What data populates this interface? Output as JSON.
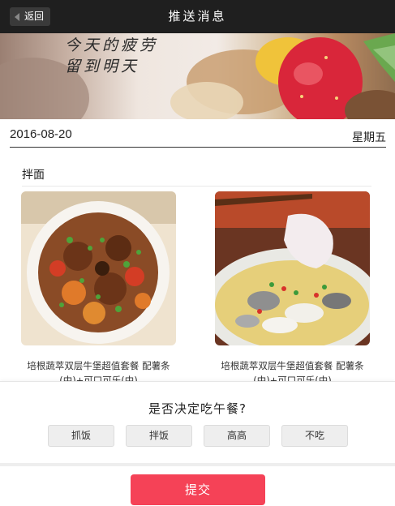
{
  "header": {
    "back_label": "返回",
    "title": "推送消息"
  },
  "banner": {
    "caption_line1": "今天的疲劳",
    "caption_line2": "留到明天"
  },
  "date_row": {
    "date": "2016-08-20",
    "weekday": "星期五"
  },
  "section": {
    "title": "拌面",
    "items": [
      {
        "description": "培根蔬萃双层牛堡超值套餐 配薯条(中)+可口可乐(中)",
        "image": "braised-meat-bowl-image"
      },
      {
        "description": "培根蔬萃双层牛堡超值套餐 配薯条(中)+可口可乐(中)",
        "image": "fish-slice-soup-image"
      }
    ]
  },
  "question_panel": {
    "question": "是否决定吃午餐?",
    "options": [
      "抓饭",
      "拌饭",
      "高高",
      "不吃"
    ]
  },
  "submit": {
    "label": "提交"
  },
  "colors": {
    "header_bg": "#1f1f1f",
    "accent": "#f54257"
  }
}
